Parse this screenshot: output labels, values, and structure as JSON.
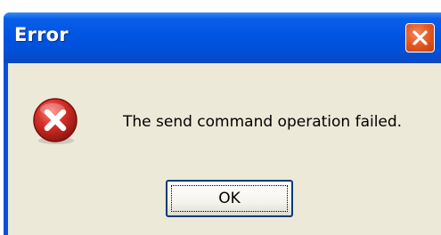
{
  "window": {
    "title": "Error"
  },
  "dialog": {
    "message": "The send command operation failed.",
    "icon": "error-icon",
    "ok_label": "OK"
  },
  "colors": {
    "titlebar": "#0054e3",
    "close_button": "#e0541e",
    "client": "#ece9d8",
    "error_red": "#d32a20"
  }
}
